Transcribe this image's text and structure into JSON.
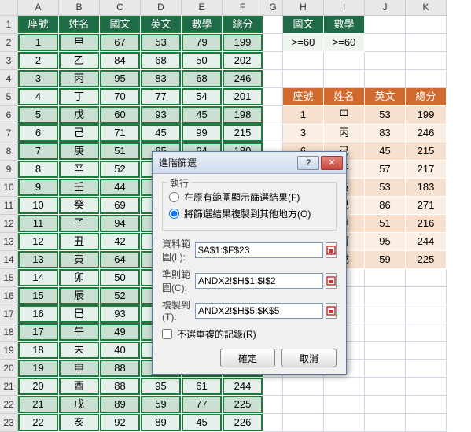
{
  "cols": [
    "A",
    "B",
    "C",
    "D",
    "E",
    "F",
    "G",
    "H",
    "I",
    "J",
    "K"
  ],
  "mainHeaders": [
    "座號",
    "姓名",
    "國文",
    "英文",
    "數學",
    "總分"
  ],
  "mainRows": [
    [
      "1",
      "甲",
      "67",
      "53",
      "79",
      "199"
    ],
    [
      "2",
      "乙",
      "84",
      "68",
      "50",
      "202"
    ],
    [
      "3",
      "丙",
      "95",
      "83",
      "68",
      "246"
    ],
    [
      "4",
      "丁",
      "70",
      "77",
      "54",
      "201"
    ],
    [
      "5",
      "戊",
      "60",
      "93",
      "45",
      "198"
    ],
    [
      "6",
      "己",
      "71",
      "45",
      "99",
      "215"
    ],
    [
      "7",
      "庚",
      "51",
      "65",
      "64",
      "180"
    ],
    [
      "8",
      "辛",
      "52",
      "",
      "",
      "",
      ""
    ],
    [
      "9",
      "壬",
      "44",
      "",
      "",
      "",
      ""
    ],
    [
      "10",
      "癸",
      "69",
      "",
      "",
      "",
      ""
    ],
    [
      "11",
      "子",
      "94",
      "",
      "",
      "",
      ""
    ],
    [
      "12",
      "丑",
      "42",
      "",
      "",
      "",
      ""
    ],
    [
      "13",
      "寅",
      "64",
      "",
      "",
      "",
      ""
    ],
    [
      "14",
      "卯",
      "50",
      "",
      "",
      "",
      ""
    ],
    [
      "15",
      "辰",
      "52",
      "",
      "",
      "",
      ""
    ],
    [
      "16",
      "巳",
      "93",
      "",
      "",
      "",
      ""
    ],
    [
      "17",
      "午",
      "49",
      "",
      "",
      "",
      ""
    ],
    [
      "18",
      "未",
      "40",
      "",
      "",
      "",
      ""
    ],
    [
      "19",
      "申",
      "88",
      "",
      "",
      "",
      ""
    ],
    [
      "20",
      "酉",
      "88",
      "95",
      "61",
      "244"
    ],
    [
      "21",
      "戌",
      "89",
      "59",
      "77",
      "225"
    ],
    [
      "22",
      "亥",
      "92",
      "89",
      "45",
      "226"
    ]
  ],
  "criteriaHeaders": [
    "國文",
    "數學"
  ],
  "criteriaValues": [
    ">=60",
    ">=60"
  ],
  "resultHeaders": [
    "座號",
    "姓名",
    "英文",
    "總分"
  ],
  "resultRows": [
    [
      "1",
      "甲",
      "53",
      "199"
    ],
    [
      "3",
      "丙",
      "83",
      "246"
    ],
    [
      "6",
      "己",
      "45",
      "215"
    ],
    [
      "",
      "子",
      "57",
      "217"
    ],
    [
      "",
      "寅",
      "53",
      "183"
    ],
    [
      "",
      "巳",
      "86",
      "271"
    ],
    [
      "",
      "申",
      "51",
      "216"
    ],
    [
      "",
      "酉",
      "95",
      "244"
    ],
    [
      "",
      "戌",
      "59",
      "225"
    ]
  ],
  "dialog": {
    "title": "進階篩選",
    "group": "執行",
    "radio1": "在原有範圍顯示篩選結果(F)",
    "radio2": "將篩選結果複製到其他地方(O)",
    "label1": "資料範圍(L):",
    "val1": "$A$1:$F$23",
    "label2": "準則範圍(C):",
    "val2": "ANDX2!$H$1:$I$2",
    "label3": "複製到(T):",
    "val3": "ANDX2!$H$5:$K$5",
    "chk": "不選重複的記錄(R)",
    "ok": "確定",
    "cancel": "取消"
  }
}
